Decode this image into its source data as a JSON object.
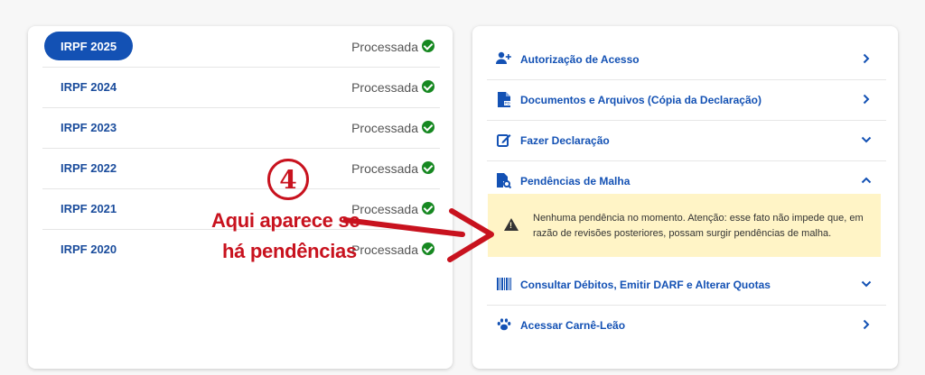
{
  "years": [
    {
      "label": "IRPF 2025",
      "status": "Processada",
      "active": true
    },
    {
      "label": "IRPF 2024",
      "status": "Processada",
      "active": false
    },
    {
      "label": "IRPF 2023",
      "status": "Processada",
      "active": false
    },
    {
      "label": "IRPF 2022",
      "status": "Processada",
      "active": false
    },
    {
      "label": "IRPF 2021",
      "status": "Processada",
      "active": false
    },
    {
      "label": "IRPF 2020",
      "status": "Processada",
      "active": false
    }
  ],
  "menu": [
    {
      "label": "Autorização de Acesso",
      "icon": "user-plus-icon",
      "chevron": "chevron-right-icon"
    },
    {
      "label": "Documentos e Arquivos (Cópia da Declaração)",
      "icon": "document-pdf-icon",
      "chevron": "chevron-right-icon"
    },
    {
      "label": "Fazer Declaração",
      "icon": "edit-icon",
      "chevron": "chevron-down-icon"
    },
    {
      "label": "Pendências de Malha",
      "icon": "file-search-icon",
      "chevron": "chevron-up-icon"
    },
    {
      "label": "Consultar Débitos, Emitir DARF e Alterar Quotas",
      "icon": "barcode-icon",
      "chevron": "chevron-down-icon"
    },
    {
      "label": "Acessar Carnê-Leão",
      "icon": "paw-icon",
      "chevron": "chevron-right-icon"
    }
  ],
  "notice": {
    "text": "Nenhuma pendência no momento. Atenção: esse fato não impede que, em razão de revisões posteriores, possam surgir pendências de malha.",
    "icon": "warning-icon",
    "background": "#fff4c6"
  },
  "annotation": {
    "number": "4",
    "line1": "Aqui aparece se",
    "line2": "há pendências",
    "color": "#c8121e"
  },
  "colors": {
    "primary": "#1351b4",
    "success": "#168821",
    "link": "#1351b4"
  }
}
